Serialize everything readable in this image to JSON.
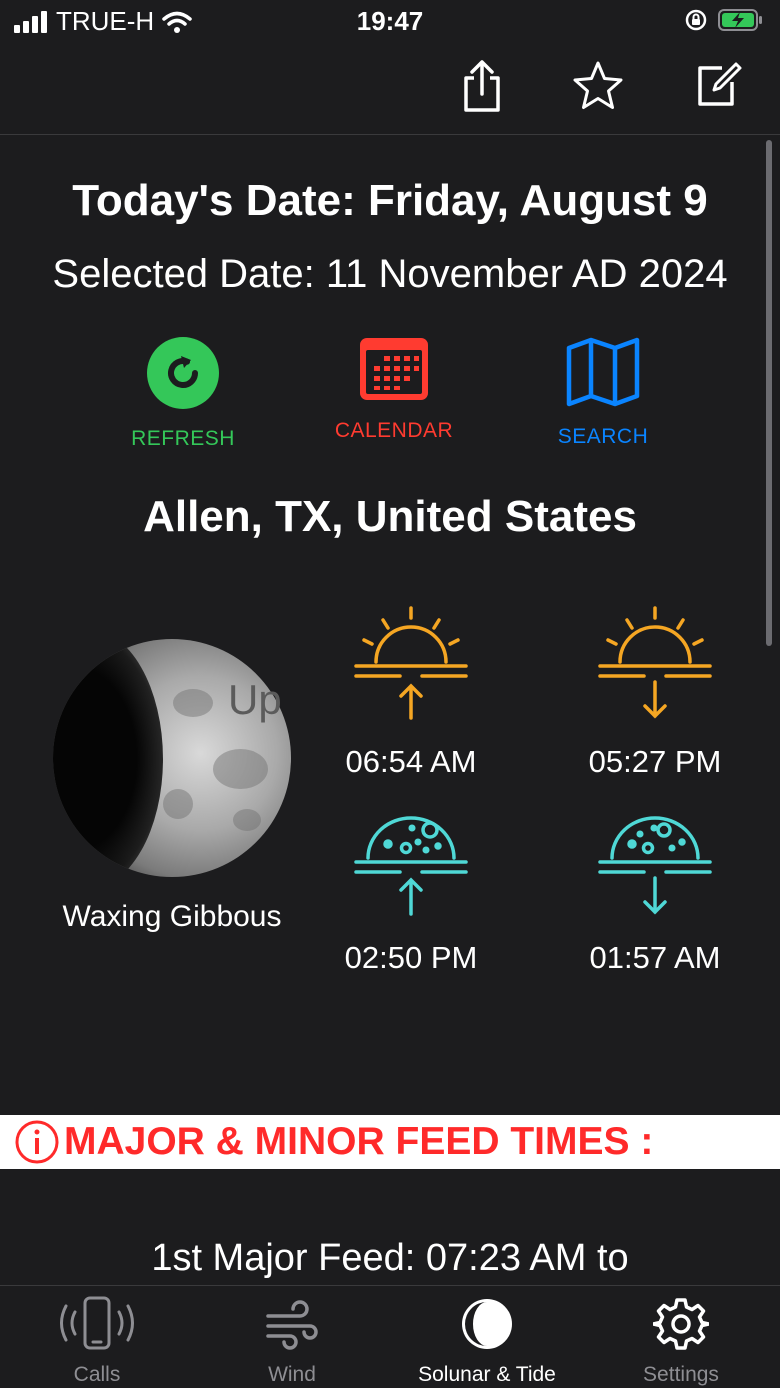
{
  "status_bar": {
    "carrier": "TRUE-H",
    "time": "19:47"
  },
  "toolbar": {
    "icons": [
      "share-icon",
      "star-icon",
      "edit-icon"
    ]
  },
  "header": {
    "today": "Today's Date: Friday, August 9",
    "selected": "Selected Date: 11 November AD 2024"
  },
  "actions": [
    {
      "label": "REFRESH",
      "icon": "refresh-icon",
      "color": "#34c759"
    },
    {
      "label": "CALENDAR",
      "icon": "calendar-icon",
      "color": "#ff3b30"
    },
    {
      "label": "SEARCH",
      "icon": "map-icon",
      "color": "#0a84ff"
    }
  ],
  "location": "Allen, TX, United States",
  "moon": {
    "phase": "Waxing Gibbous",
    "overlay": "Up"
  },
  "times": {
    "sunrise": "06:54 AM",
    "sunset": "05:27 PM",
    "moonrise": "02:50 PM",
    "moonset": "01:57 AM"
  },
  "colors": {
    "sun": "#f5a623",
    "moon": "#4fd8d6",
    "banner_text": "#ff2a2a"
  },
  "banner": {
    "title": "MAJOR & MINOR FEED TIMES :"
  },
  "feed": {
    "first_major": "1st Major Feed: 07:23 AM to"
  },
  "tabbar": {
    "tabs": [
      {
        "label": "Calls",
        "icon": "phone-icon"
      },
      {
        "label": "Wind",
        "icon": "wind-icon"
      },
      {
        "label": "Solunar & Tide",
        "icon": "moon-icon"
      },
      {
        "label": "Settings",
        "icon": "gear-icon"
      }
    ],
    "active": "Solunar & Tide"
  }
}
